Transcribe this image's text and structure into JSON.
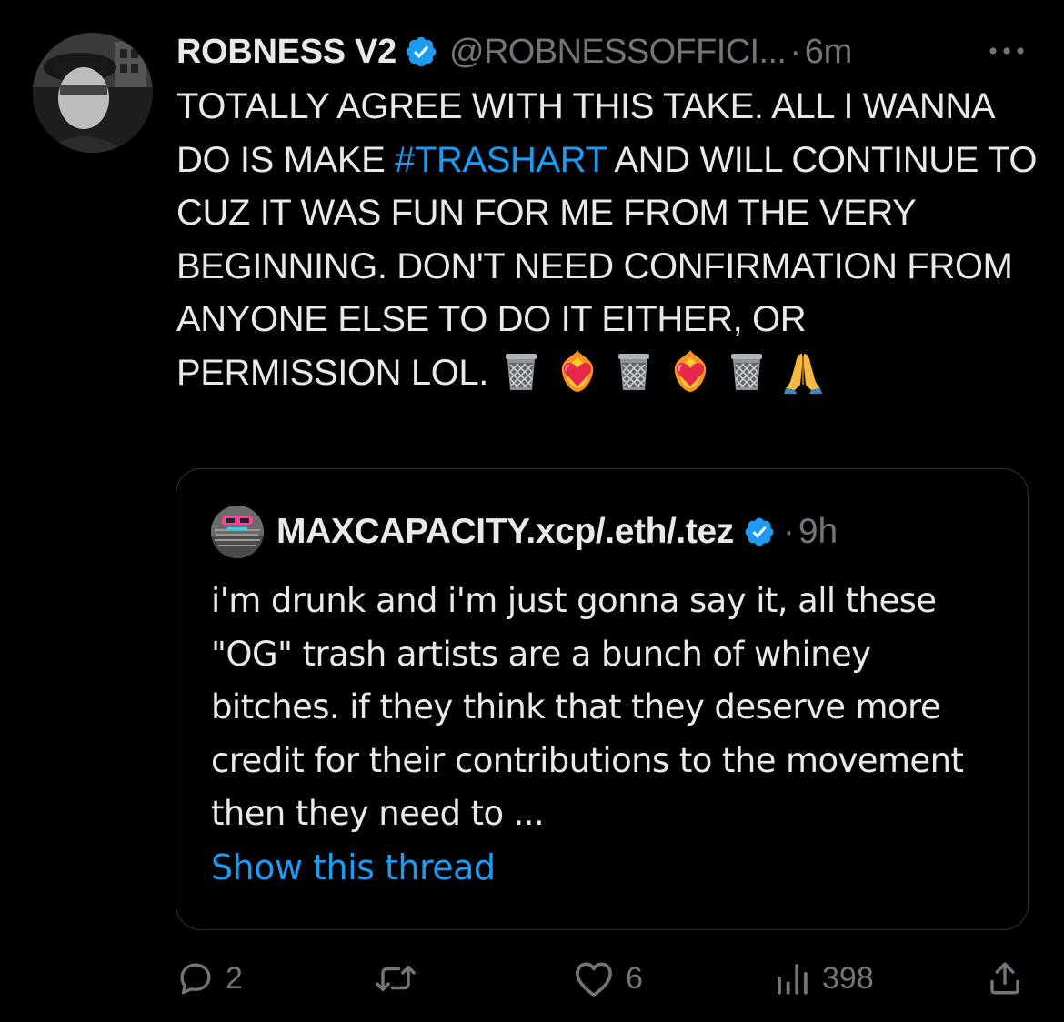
{
  "author": {
    "display_name": "ROBNESS V2",
    "handle": "@ROBNESSOFFICI...",
    "separator": "·",
    "time": "6m",
    "avatar_icon": "profile-photo"
  },
  "tweet": {
    "text_before_hashtag": "TOTALLY AGREE WITH THIS TAKE.  ALL I WANNA DO IS MAKE ",
    "hashtag": "#TRASHART",
    "text_after_hashtag": " AND WILL CONTINUE TO CUZ IT WAS FUN FOR ME FROM THE VERY BEGINNING.  DON'T NEED CONFIRMATION FROM ANYONE ELSE TO DO IT EITHER, OR PERMISSION LOL. ",
    "emojis": [
      "wastebasket",
      "heart-on-fire",
      "wastebasket",
      "heart-on-fire",
      "wastebasket",
      "folded-hands"
    ]
  },
  "quote": {
    "display_name": "MAXCAPACITY.xcp/.eth/.tez",
    "separator": "·",
    "time": "9h",
    "text": "i'm drunk and i'm just gonna say it, all these \"OG\" trash artists are a bunch of whiney bitches. if they think that they deserve more credit for their contributions to the movement then they need to ...",
    "show_thread": "Show this thread"
  },
  "actions": {
    "replies": "2",
    "retweets": "",
    "likes": "6",
    "views": "398"
  },
  "colors": {
    "background": "#000000",
    "text": "#e7e9ea",
    "muted": "#71767b",
    "accent": "#1d9bf0",
    "border": "#2f3336"
  }
}
